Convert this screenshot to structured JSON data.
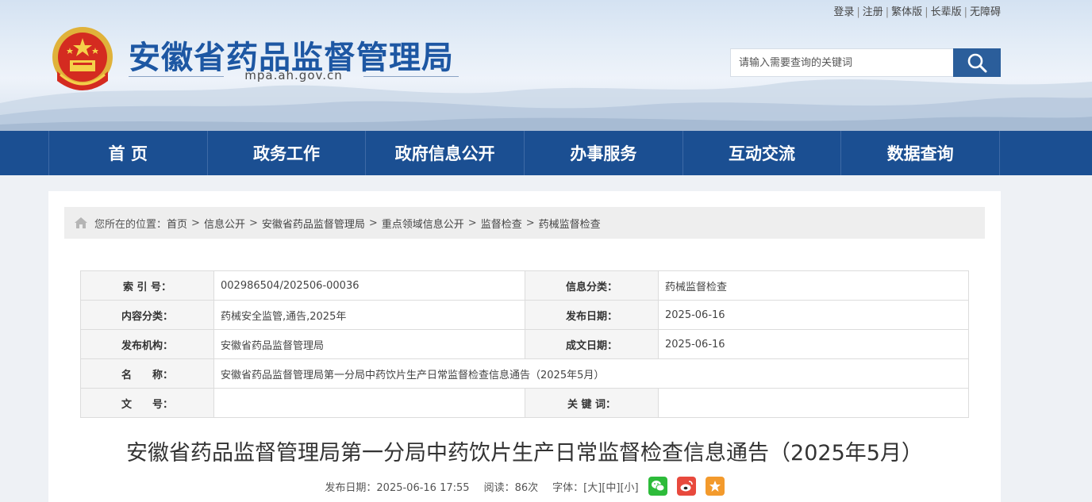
{
  "top_links": [
    "登录",
    "注册",
    "繁体版",
    "长辈版",
    "无障碍"
  ],
  "site": {
    "title": "安徽省药品监督管理局",
    "domain": "mpa.ah.gov.cn"
  },
  "search": {
    "placeholder": "请输入需要查询的关键词"
  },
  "nav": [
    "首 页",
    "政务工作",
    "政府信息公开",
    "办事服务",
    "互动交流",
    "数据查询"
  ],
  "breadcrumb": {
    "prefix": "您所在的位置：",
    "items": [
      "首页",
      "信息公开",
      "安徽省药品监督管理局",
      "重点领域信息公开",
      "监督检查",
      "药械监督检查"
    ],
    "separator": ">"
  },
  "meta": {
    "index_label": "索 引 号：",
    "index_value": "002986504/202506-00036",
    "category_label": "信息分类：",
    "category_value": "药械监督检查",
    "content_label": "内容分类：",
    "content_value": "药械安全监管,通告,2025年",
    "pubdate_label": "发布日期：",
    "pubdate_value": "2025-06-16",
    "org_label": "发布机构：",
    "org_value": "安徽省药品监督管理局",
    "writedate_label": "成文日期：",
    "writedate_value": "2025-06-16",
    "name_label": "名　　称：",
    "name_value": "安徽省药品监督管理局第一分局中药饮片生产日常监督检查信息通告（2025年5月）",
    "docno_label": "文　　号：",
    "docno_value": "",
    "keywords_label": "关 键 词：",
    "keywords_value": ""
  },
  "article": {
    "title": "安徽省药品监督管理局第一分局中药饮片生产日常监督检查信息通告（2025年5月）",
    "date_text": "发布日期：2025-06-16 17:55",
    "views_text": "阅读：86次",
    "font_label": "字体：",
    "font_large": "[大]",
    "font_medium": "[中]",
    "font_small": "[小]"
  },
  "colors": {
    "brand": "#1b4f92",
    "title": "#1d57a3",
    "wechat": "#2dbb3a",
    "weibo": "#e8493d",
    "favorite": "#f39a2c"
  },
  "icons": {
    "search": "search-icon",
    "home": "home-icon",
    "wechat": "wechat-icon",
    "weibo": "weibo-icon",
    "favorite": "star-icon"
  }
}
